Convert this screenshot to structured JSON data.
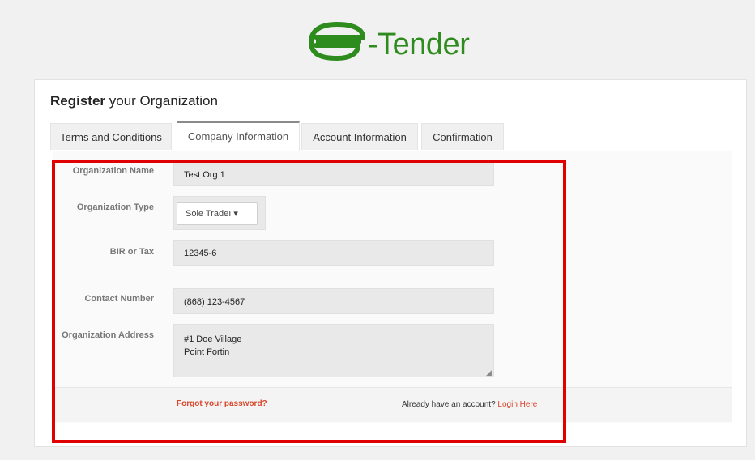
{
  "logo": {
    "text": "-Tender",
    "color": "#2e8b1e"
  },
  "register": {
    "bold": "Register",
    "rest": " your Organization"
  },
  "tabs": [
    {
      "label": "Terms and Conditions"
    },
    {
      "label": "Company Information"
    },
    {
      "label": "Account Information"
    },
    {
      "label": "Confirmation"
    }
  ],
  "form": {
    "org_name_label": "Organization Name",
    "org_name_value": "Test Org 1",
    "org_type_label": "Organization Type",
    "org_type_value": "Sole Tradeı ▾",
    "bir_label": "BIR or Tax",
    "bir_value": "12345-6",
    "contact_label": "Contact Number",
    "contact_value": "(868) 123-4567",
    "address_label": "Organization Address",
    "address_line1": "#1 Doe Village",
    "address_line2": "Point Fortin"
  },
  "footer": {
    "forgot": "Forgot your password?",
    "already": "Already have an account?",
    "login": " Login Here"
  },
  "annotation": {
    "color": "#e00000"
  }
}
